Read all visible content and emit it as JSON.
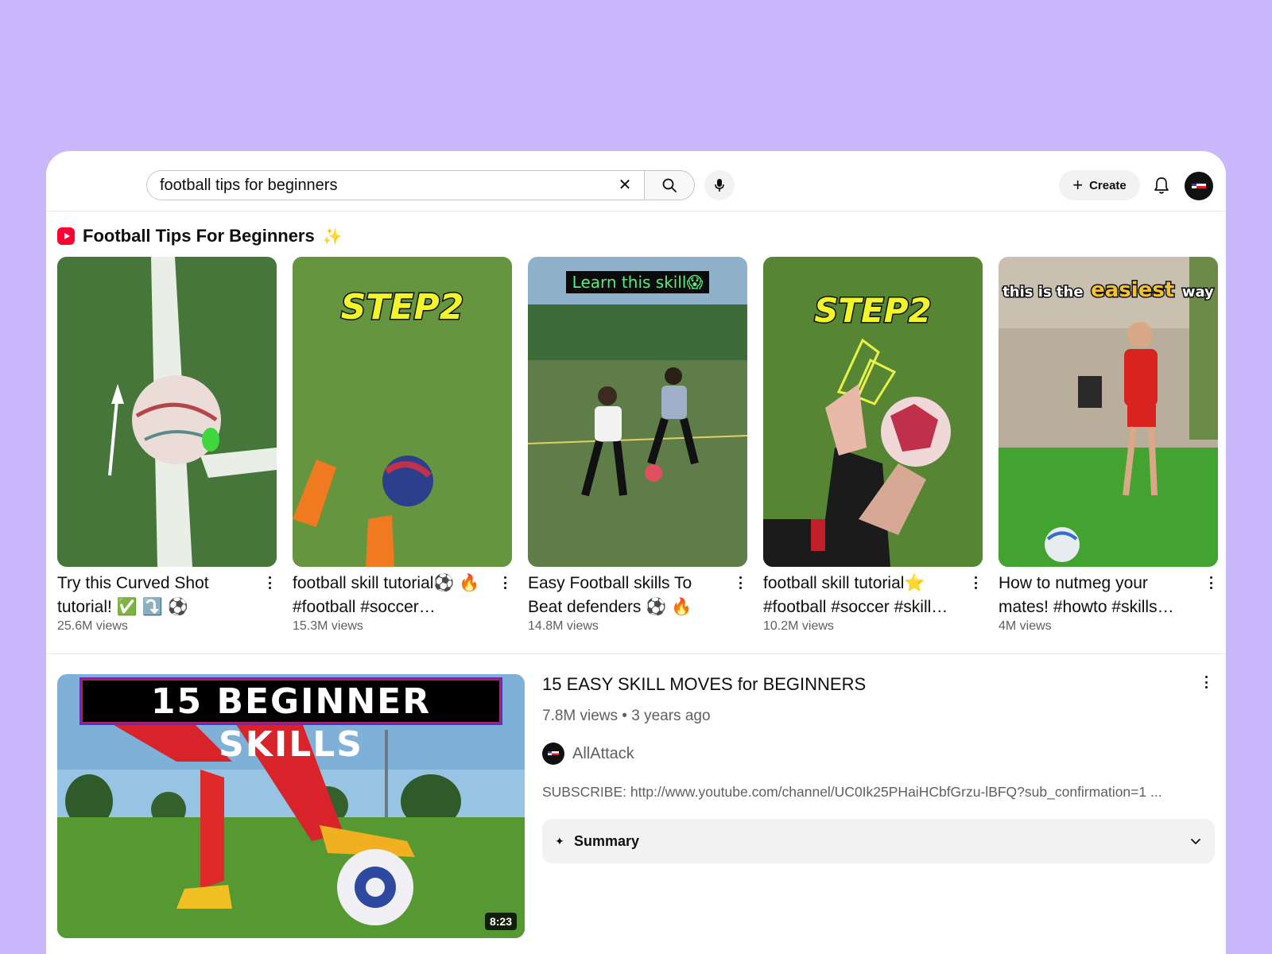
{
  "search": {
    "query": "football tips for beginners",
    "clear_icon": "close-icon",
    "search_icon": "search-icon",
    "mic_icon": "microphone-icon"
  },
  "header": {
    "create_label": "Create",
    "notifications_icon": "bell-icon"
  },
  "shelf": {
    "title": "Football Tips For Beginners",
    "sparkle": "✨",
    "shorts": [
      {
        "title": "Try this Curved Shot tutorial! ✅ ⤵️ ⚽",
        "views": "25.6M views",
        "overlay_text": ""
      },
      {
        "title": "football skill tutorial⚽ 🔥 #football #soccer…",
        "views": "15.3M views",
        "overlay_text": "STEP2"
      },
      {
        "title": "Easy Football skills To Beat defenders ⚽ 🔥",
        "views": "14.8M views",
        "overlay_text": "Learn this skill😱"
      },
      {
        "title": "football skill tutorial⭐ #football #soccer #skill…",
        "views": "10.2M views",
        "overlay_text": "STEP2"
      },
      {
        "title": "How to nutmeg your mates! #howto #skills…",
        "views": "4M views",
        "overlay_text_a": "this is the",
        "overlay_text_b": "easiest",
        "overlay_text_c": "way"
      }
    ]
  },
  "video": {
    "thumbnail_text": "15 BEGINNER SKILLS",
    "duration": "8:23",
    "title": "15 EASY SKILL MOVES for BEGINNERS",
    "meta": "7.8M views • 3 years ago",
    "channel": "AllAttack",
    "description": "SUBSCRIBE: http://www.youtube.com/channel/UC0Ik25PHaiHCbfGrzu-lBFQ?sub_confirmation=1 ...",
    "summary_label": "Summary",
    "summary_icon": "sparkle-icon"
  },
  "colors": {
    "background": "#c9b8fb",
    "shorts_red": "#ff0033",
    "grass": "#4f8a2f",
    "text_secondary": "#606060"
  }
}
